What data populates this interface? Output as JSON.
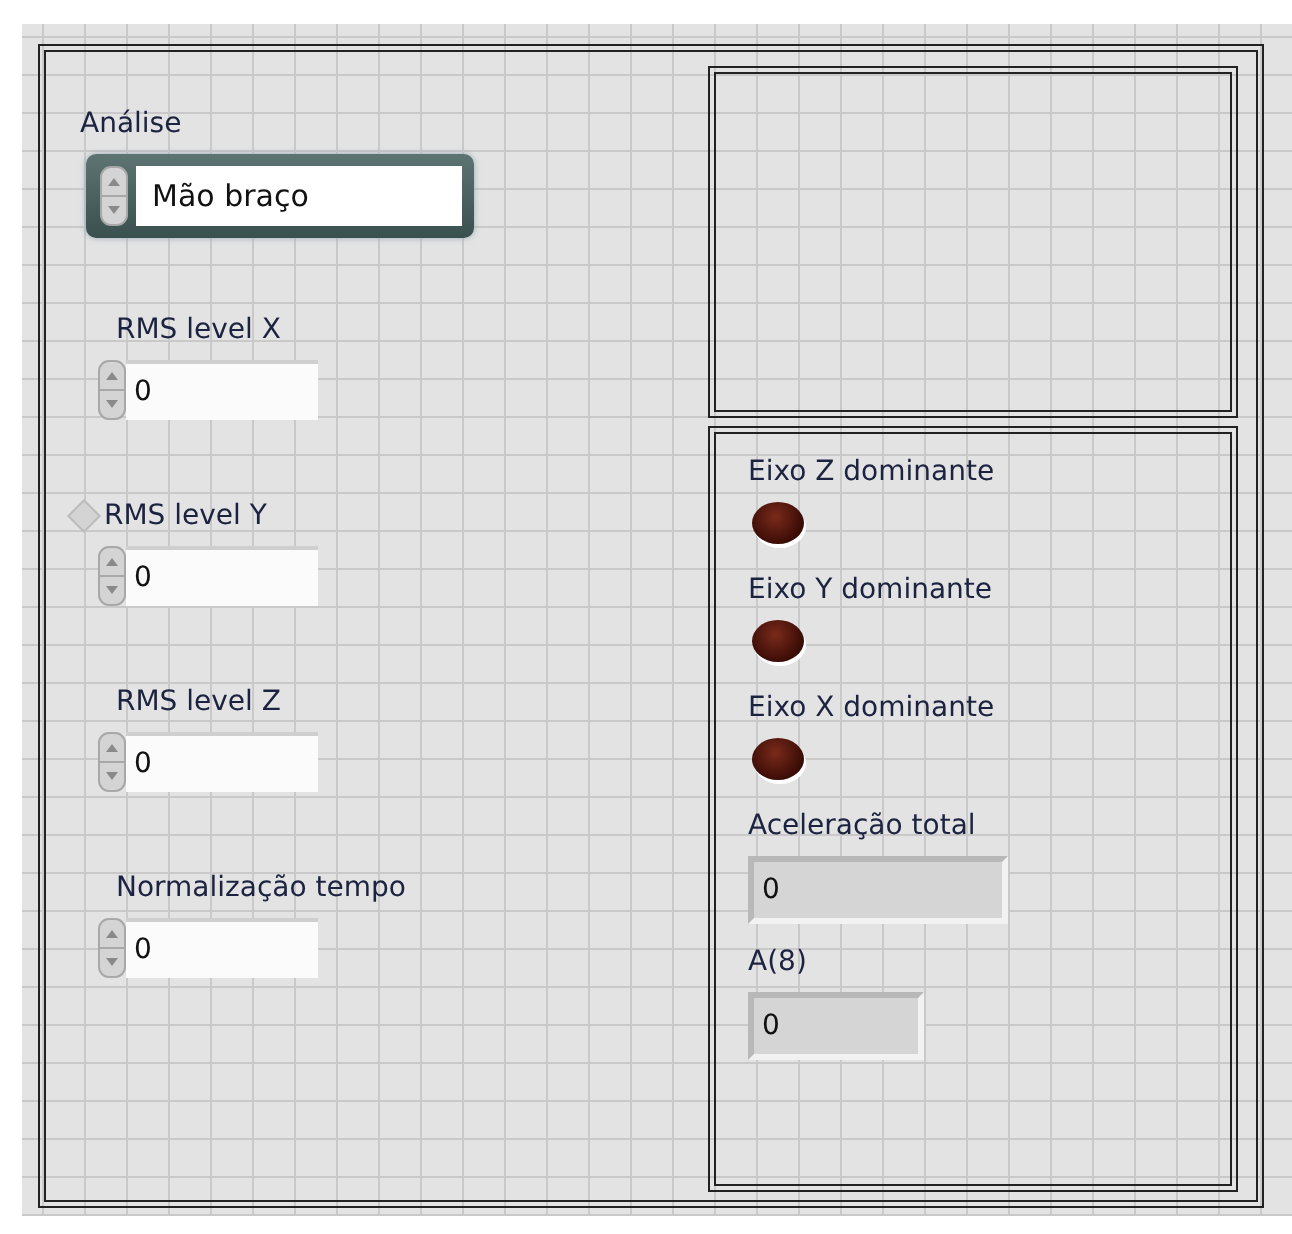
{
  "ring_control": {
    "label": "Análise",
    "value": "Mão braço"
  },
  "numeric_controls": [
    {
      "label": "RMS level X",
      "value": "0",
      "tip": false
    },
    {
      "label": "RMS level Y",
      "value": "0",
      "tip": true
    },
    {
      "label": "RMS level Z",
      "value": "0",
      "tip": false
    },
    {
      "label": "Normalização tempo",
      "value": "0",
      "tip": false
    }
  ],
  "leds": [
    {
      "label": "Eixo Z dominante",
      "on": false
    },
    {
      "label": "Eixo Y dominante",
      "on": false
    },
    {
      "label": "Eixo X dominante",
      "on": false
    }
  ],
  "indicators": [
    {
      "label": "Aceleração total",
      "value": "0"
    },
    {
      "label": "A(8)",
      "value": "0"
    }
  ]
}
